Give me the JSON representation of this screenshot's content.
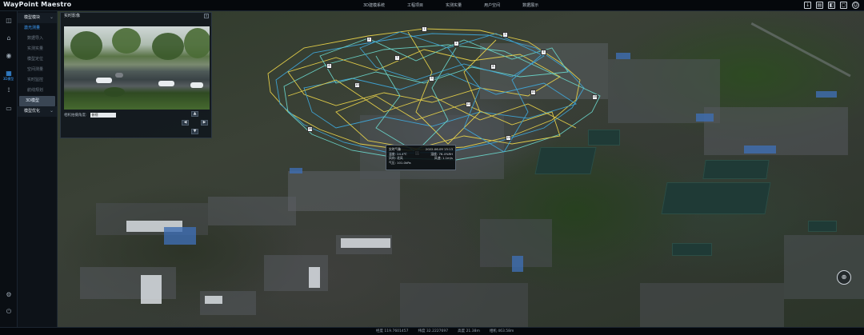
{
  "app": {
    "title": "WayPoint Maestro"
  },
  "nav": [
    "3D建模系统",
    "工程项目",
    "实测实量",
    "用户空间",
    "数据展示"
  ],
  "top_icons": [
    "download-icon",
    "export-icon",
    "layers-icon",
    "window-icon",
    "user-icon"
  ],
  "rail": {
    "items": [
      "layers-icon",
      "home-icon",
      "eye-icon",
      "chart-icon",
      "route-icon",
      "document-icon"
    ],
    "active_label": "3D模型",
    "bottom": [
      "settings-icon",
      "logout-icon"
    ]
  },
  "menu": {
    "group1": "模型模块",
    "items": [
      "激光测量",
      "数据导入",
      "实测实量",
      "模型定位",
      "空间测量",
      "实时监控",
      "航线规划",
      "3D模型"
    ],
    "group2": "模型优化"
  },
  "panel": {
    "title": "实时影像",
    "ctrl_label": "相机拍摄角度:",
    "ctrl_value": "俯视"
  },
  "popup": {
    "rows": [
      [
        "实时气象",
        "2022-06-09 15:13"
      ],
      [
        "温度: 24.4℃",
        "湿度: 76.4%RH"
      ],
      [
        "风向: 北风",
        "风速: 1.1m/s"
      ],
      [
        "气压: 101.0kPa",
        ""
      ]
    ]
  },
  "status": {
    "items": [
      "经度 119.7601457",
      "纬度 32.2227697",
      "高度 21.38m",
      "相机 463.58m"
    ]
  },
  "waypoints": [
    "1",
    "2",
    "3",
    "4",
    "5",
    "6",
    "7",
    "8",
    "9",
    "10",
    "11",
    "12",
    "13",
    "14",
    "15",
    "16"
  ],
  "colors": {
    "accent": "#3ea0ff",
    "route_yellow": "#e8d24a",
    "route_blue": "#3fa6d8",
    "route_cyan": "#6ad3c8"
  }
}
